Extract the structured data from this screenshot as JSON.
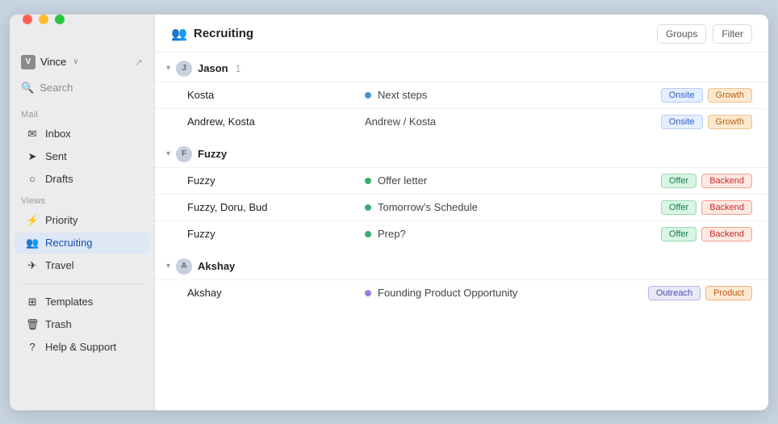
{
  "window": {
    "title": "Recruiting"
  },
  "trafficLights": {
    "red": "red",
    "yellow": "yellow",
    "green": "green"
  },
  "sidebar": {
    "user": {
      "name": "Vince",
      "chevron": "∨",
      "icon_label": "V"
    },
    "search": {
      "label": "Search"
    },
    "mail_section": {
      "label": "Mail",
      "items": [
        {
          "id": "inbox",
          "label": "Inbox",
          "icon": "✉"
        },
        {
          "id": "sent",
          "label": "Sent",
          "icon": "➤"
        },
        {
          "id": "drafts",
          "label": "Drafts",
          "icon": "○"
        }
      ]
    },
    "views_section": {
      "label": "Views",
      "items": [
        {
          "id": "priority",
          "label": "Priority",
          "icon": "⚡"
        },
        {
          "id": "recruiting",
          "label": "Recruiting",
          "icon": "👥",
          "active": true
        },
        {
          "id": "travel",
          "label": "Travel",
          "icon": "✈"
        }
      ]
    },
    "footer_items": [
      {
        "id": "templates",
        "label": "Templates",
        "icon": "⊞"
      },
      {
        "id": "trash",
        "label": "Trash",
        "icon": "🗑"
      },
      {
        "id": "help",
        "label": "Help & Support",
        "icon": "?"
      }
    ]
  },
  "main": {
    "title": "Recruiting",
    "title_icon": "👥",
    "header_buttons": [
      {
        "id": "groups",
        "label": "Groups"
      },
      {
        "id": "filter",
        "label": "Filter"
      }
    ],
    "groups": [
      {
        "id": "jason",
        "name": "Jason",
        "avatar": "J",
        "count": "1",
        "rows": [
          {
            "name": "Kosta",
            "dot_color": "dot-blue",
            "step": "Next steps",
            "tags": [
              {
                "label": "Onsite",
                "class": "tag-onsite"
              },
              {
                "label": "Growth",
                "class": "tag-growth"
              }
            ]
          },
          {
            "name": "Andrew, Kosta",
            "dot_color": null,
            "step": "Andrew / Kosta",
            "tags": [
              {
                "label": "Onsite",
                "class": "tag-onsite"
              },
              {
                "label": "Growth",
                "class": "tag-growth"
              }
            ]
          }
        ]
      },
      {
        "id": "fuzzy",
        "name": "Fuzzy",
        "avatar": "F",
        "count": "",
        "rows": [
          {
            "name": "Fuzzy",
            "dot_color": "dot-green",
            "step": "Offer letter",
            "tags": [
              {
                "label": "Offer",
                "class": "tag-offer"
              },
              {
                "label": "Backend",
                "class": "tag-backend"
              }
            ]
          },
          {
            "name": "Fuzzy, Doru, Bud",
            "dot_color": "dot-green",
            "step": "Tomorrow's Schedule",
            "tags": [
              {
                "label": "Offer",
                "class": "tag-offer"
              },
              {
                "label": "Backend",
                "class": "tag-backend"
              }
            ]
          },
          {
            "name": "Fuzzy",
            "dot_color": "dot-green",
            "step": "Prep?",
            "tags": [
              {
                "label": "Offer",
                "class": "tag-offer"
              },
              {
                "label": "Backend",
                "class": "tag-backend"
              }
            ]
          }
        ]
      },
      {
        "id": "akshay",
        "name": "Akshay",
        "avatar": "A",
        "count": "",
        "rows": [
          {
            "name": "Akshay",
            "dot_color": "dot-purple",
            "step": "Founding Product Opportunity",
            "tags": [
              {
                "label": "Outreach",
                "class": "tag-outreach"
              },
              {
                "label": "Product",
                "class": "tag-product"
              }
            ]
          }
        ]
      }
    ]
  }
}
